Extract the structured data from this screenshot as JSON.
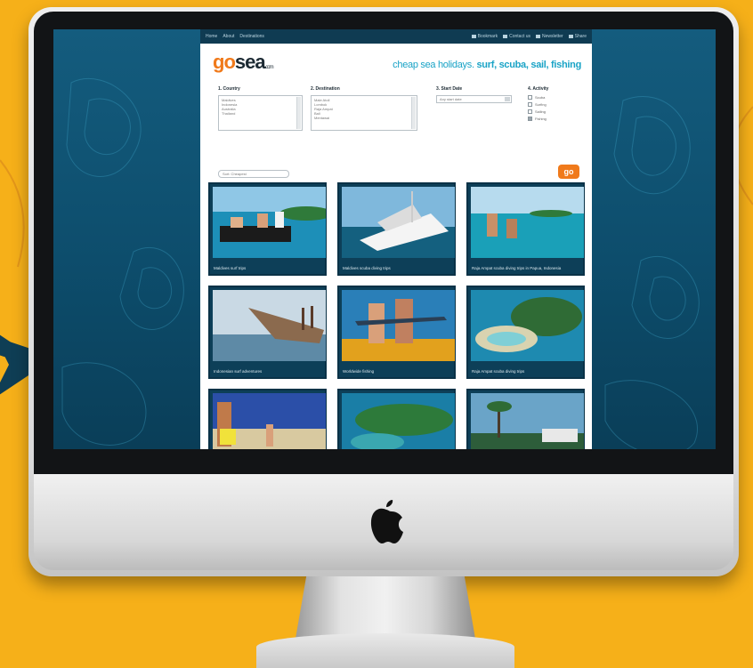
{
  "nav": {
    "links": [
      "Home",
      "About",
      "Destinations"
    ],
    "utilities": [
      "Bookmark",
      "Contact us",
      "Newsletter",
      "Share"
    ]
  },
  "brand": {
    "logo_go": "go",
    "logo_sea": "sea",
    "logo_suffix": ".com",
    "tagline_lead": "cheap sea holidays.",
    "tagline_activities": "surf, scuba, sail, fishing"
  },
  "search": {
    "country": {
      "title": "1. Country",
      "options": [
        "Maldives",
        "Indonesia",
        "Australia",
        "Thailand"
      ]
    },
    "destination": {
      "title": "2. Destination",
      "options": [
        "Male Atoll",
        "Lombok",
        "Raja Ampat",
        "Bali",
        "Mentawai"
      ]
    },
    "start_date": {
      "title": "3. Start Date",
      "placeholder": "Any start date"
    },
    "activity": {
      "title": "4. Activity",
      "options": [
        {
          "label": "Scuba",
          "checked": false
        },
        {
          "label": "Surfing",
          "checked": false
        },
        {
          "label": "Sailing",
          "checked": false
        },
        {
          "label": "Fishing",
          "checked": true
        }
      ]
    },
    "sort_label": "Sort: Cheapest",
    "go_label": "go"
  },
  "gallery": {
    "tiles": [
      {
        "caption": "Maldives surf trips"
      },
      {
        "caption": "Maldives scuba diving trips"
      },
      {
        "caption": "Raja Ampat scuba diving trips in Papua, Indonesia"
      },
      {
        "caption": "Indonesian surf adventures"
      },
      {
        "caption": "Worldwide fishing"
      },
      {
        "caption": "Raja Ampat scuba diving trips"
      },
      {
        "caption": ""
      },
      {
        "caption": ""
      },
      {
        "caption": ""
      }
    ]
  },
  "colors": {
    "background": "#f6b019",
    "accent_orange": "#f07a1b",
    "accent_teal": "#19a3c6",
    "screen_blue": "#0d4d6c"
  },
  "icons": [
    "apple-logo-icon",
    "arrow-icon",
    "bookmark-icon",
    "mail-icon",
    "newsletter-icon",
    "share-icon"
  ]
}
